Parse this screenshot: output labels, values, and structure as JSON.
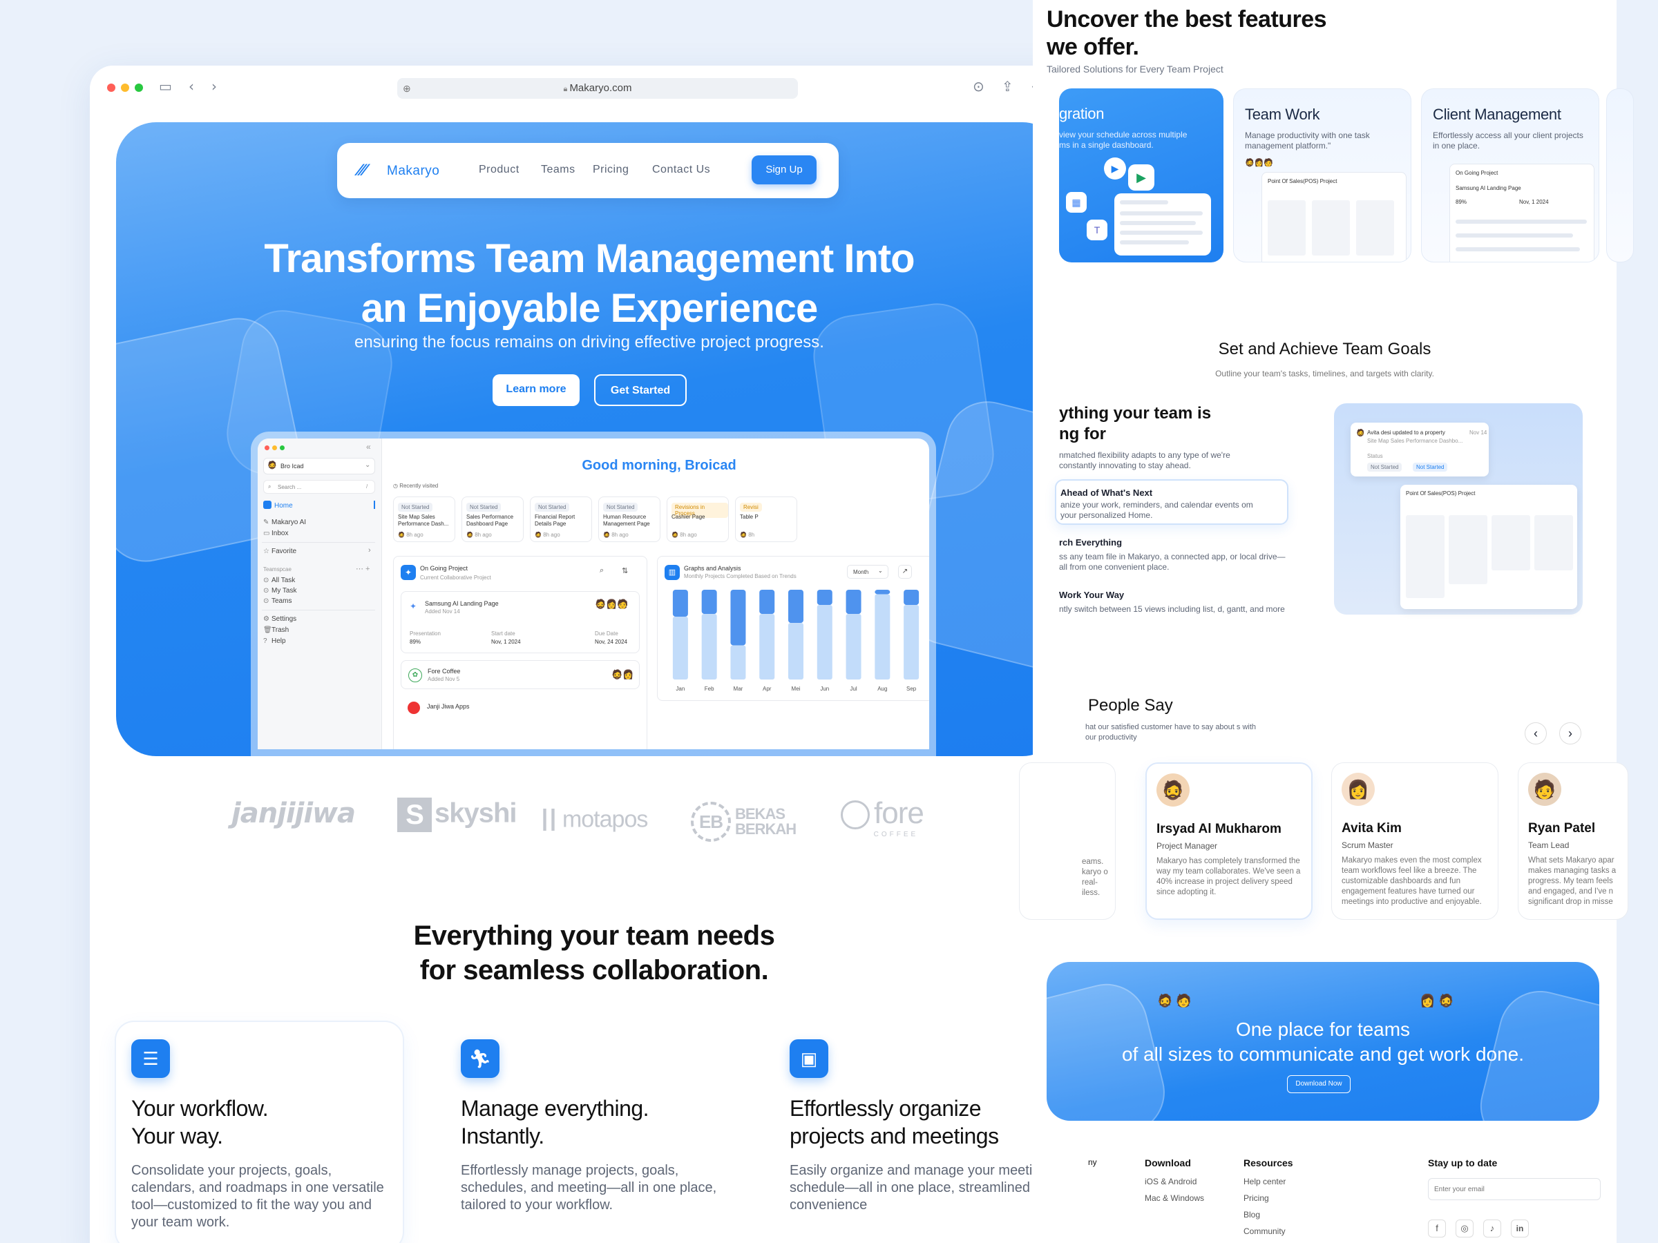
{
  "browser": {
    "url": "Makaryo.com"
  },
  "nav": {
    "brand": "Makaryo",
    "links": [
      "Product",
      "Teams",
      "Pricing",
      "Contact Us"
    ],
    "signup": "Sign Up"
  },
  "hero": {
    "title_line1": "Transforms Team Management Into",
    "title_line2": "an Enjoyable Experience",
    "subtitle": "ensuring the focus remains on driving effective project progress.",
    "learn_more": "Learn more",
    "get_started": "Get Started"
  },
  "app": {
    "user": "Bro Icad",
    "search_placeholder": "Search ...",
    "search_shortcut": "/",
    "menu": [
      "Home",
      "Makaryo AI",
      "Inbox"
    ],
    "favorite": "Favorite",
    "teamspace_label": "Teamspcae",
    "teamspace_items": [
      "All Task",
      "My Task",
      "Teams"
    ],
    "bottom_items": [
      "Settings",
      "Trash",
      "Help"
    ],
    "greeting": "Good morning, Broicad",
    "recently_visited": "Recently visited",
    "recent": [
      {
        "status": "Not Started",
        "title": "Site Map Sales Performance Dash...",
        "time": "8h ago"
      },
      {
        "status": "Not Started",
        "title": "Sales Performance Dashboard Page",
        "time": "8h ago"
      },
      {
        "status": "Not Started",
        "title": "Financial Report Details Page",
        "time": "8h ago"
      },
      {
        "status": "Not Started",
        "title": "Human Resource Management Page",
        "time": "8h ago"
      },
      {
        "status": "Revisions in Process",
        "title": "Cashier Page",
        "time": "8h ago"
      },
      {
        "status": "Revisi",
        "title": "Table P",
        "time": "8h"
      }
    ],
    "ongoing": {
      "title": "On Going Project",
      "subtitle": "Current Collaborative Project",
      "project1": "Samsung AI Landing Page",
      "project1_added": "Added Nov 14",
      "presentation_label": "Presentation",
      "presentation_value": "89%",
      "start_label": "Start date",
      "start_value": "Nov, 1  2024",
      "due_label": "Due Date",
      "due_value": "Nov, 24  2024",
      "project2": "Fore Coffee",
      "project2_added": "Added Nov 5",
      "project3": "Janji Jiwa Apps"
    },
    "graphs": {
      "title": "Graphs and Analysis",
      "subtitle": "Monthly Projects Completed Based on Trends",
      "period": "Month"
    }
  },
  "chart_data": {
    "type": "bar",
    "title": "Graphs and Analysis",
    "categories": [
      "Jan",
      "Feb",
      "Mar",
      "Apr",
      "Mei",
      "Jun",
      "Jul",
      "Aug",
      "Sep"
    ],
    "series": [
      {
        "values": [
          0.3,
          0.27,
          0.62,
          0.27,
          0.37,
          0.17,
          0.27,
          0.05,
          0.17
        ]
      },
      {
        "values": [
          0.7,
          0.73,
          0.38,
          0.73,
          0.63,
          0.83,
          0.73,
          0.95,
          0.83
        ]
      }
    ],
    "ylim": [
      0,
      1
    ],
    "colors": {
      "dark": "#4f93ee",
      "light": "#c2dcfa"
    }
  },
  "logos": [
    "janjijiwa",
    "skyshi",
    "motapos",
    "BEKAS BERKAH",
    "fore",
    "COFFEE"
  ],
  "features": {
    "title_line1": "Everything your team needs",
    "title_line2": "for seamless collaboration.",
    "items": [
      {
        "icon": "workflow-icon",
        "title1": "Your workflow.",
        "title2": "Your way.",
        "desc": "Consolidate your projects, goals, calendars, and roadmaps in one versatile tool—customized to fit the way you and your team work."
      },
      {
        "icon": "runner-icon",
        "title1": "Manage everything.",
        "title2": "Instantly.",
        "desc": "Effortlessly manage projects, goals, schedules, and meeting—all in one place, tailored to your workflow."
      },
      {
        "icon": "meeting-icon",
        "title1": "Effortlessly organize",
        "title2": "projects and meetings",
        "desc": "Easily organize and manage your meeting schedule—all in one place, streamlined for convenience"
      }
    ]
  },
  "right": {
    "heading_line1": "Uncover the best features",
    "heading_line2": "we offer.",
    "subheading": "Tailored Solutions for Every Team Project",
    "subheading_visible": "...red Solutions for Every Team Project",
    "cards": [
      {
        "title": "gration",
        "desc": "view your schedule across multiple ms in a single dashboard."
      },
      {
        "title": "Team Work",
        "desc": "Manage productivity with one task management platform.\""
      },
      {
        "title": "Client Management",
        "desc": "Effortlessly access all your client projects in one place."
      }
    ],
    "goals_title": "Set and Achieve Team Goals",
    "goals_sub": "Outline your team's tasks, timelines, and targets with clarity.",
    "goals_heading1": "ything your team is",
    "goals_heading2": "ng for",
    "goals_desc": "nmatched flexibility adapts to any type of we're constantly innovating to stay ahead.",
    "goals_items": [
      {
        "title": "Ahead of What's Next",
        "desc": "anize your work, reminders, and calendar events om your personalized Home."
      },
      {
        "title": "rch Everything",
        "desc": "ss any team file in Makaryo, a connected app, or local drive—all from one convenient place."
      },
      {
        "title": "Work Your Way",
        "desc": "ntly switch between 15 views including list, d, gantt, and more"
      }
    ],
    "notif": {
      "text": "Avita desi updated to a  property",
      "date": "Nov 14",
      "sub": "Site Map Sales Performance Dashbo...",
      "status_label": "Status",
      "status_from": "Not Started",
      "status_to": "Not Started"
    },
    "board_title": "Point Of Sales(POS) Project",
    "people_title": "People Say",
    "people_sub": "hat our satisfied customer have to say about s with our productivity",
    "testimonials": [
      {
        "name": "",
        "role": "",
        "quote": "eams. karyo o real- iless."
      },
      {
        "name": "Irsyad Al Mukharom",
        "role": "Project Manager",
        "quote": "Makaryo has completely transformed the way my team collaborates. We've seen a 40% increase in project delivery speed since adopting it."
      },
      {
        "name": "Avita Kim",
        "role": "Scrum Master",
        "quote": "Makaryo makes even the most complex team workflows feel like a breeze. The customizable dashboards and fun engagement features have turned our meetings into productive and enjoyable."
      },
      {
        "name": "Ryan Patel",
        "role": "Team Lead",
        "quote": "What sets Makaryo apar makes managing tasks a progress. My team feels and engaged, and I've n significant drop in misse"
      }
    ],
    "cta_line1": "One place for teams",
    "cta_line2": "of all sizes to communicate and get work done.",
    "cta_button": "Download Now",
    "footer": {
      "col0": "ny",
      "download_h": "Download",
      "download_items": [
        "iOS & Android",
        "Mac & Windows"
      ],
      "resources_h": "Resources",
      "resources_items": [
        "Help center",
        "Pricing",
        "Blog",
        "Community"
      ],
      "stay_h": "Stay up to date",
      "email_placeholder": "Enter your email",
      "socials": [
        "f",
        "◎",
        "♪",
        "in"
      ]
    }
  }
}
